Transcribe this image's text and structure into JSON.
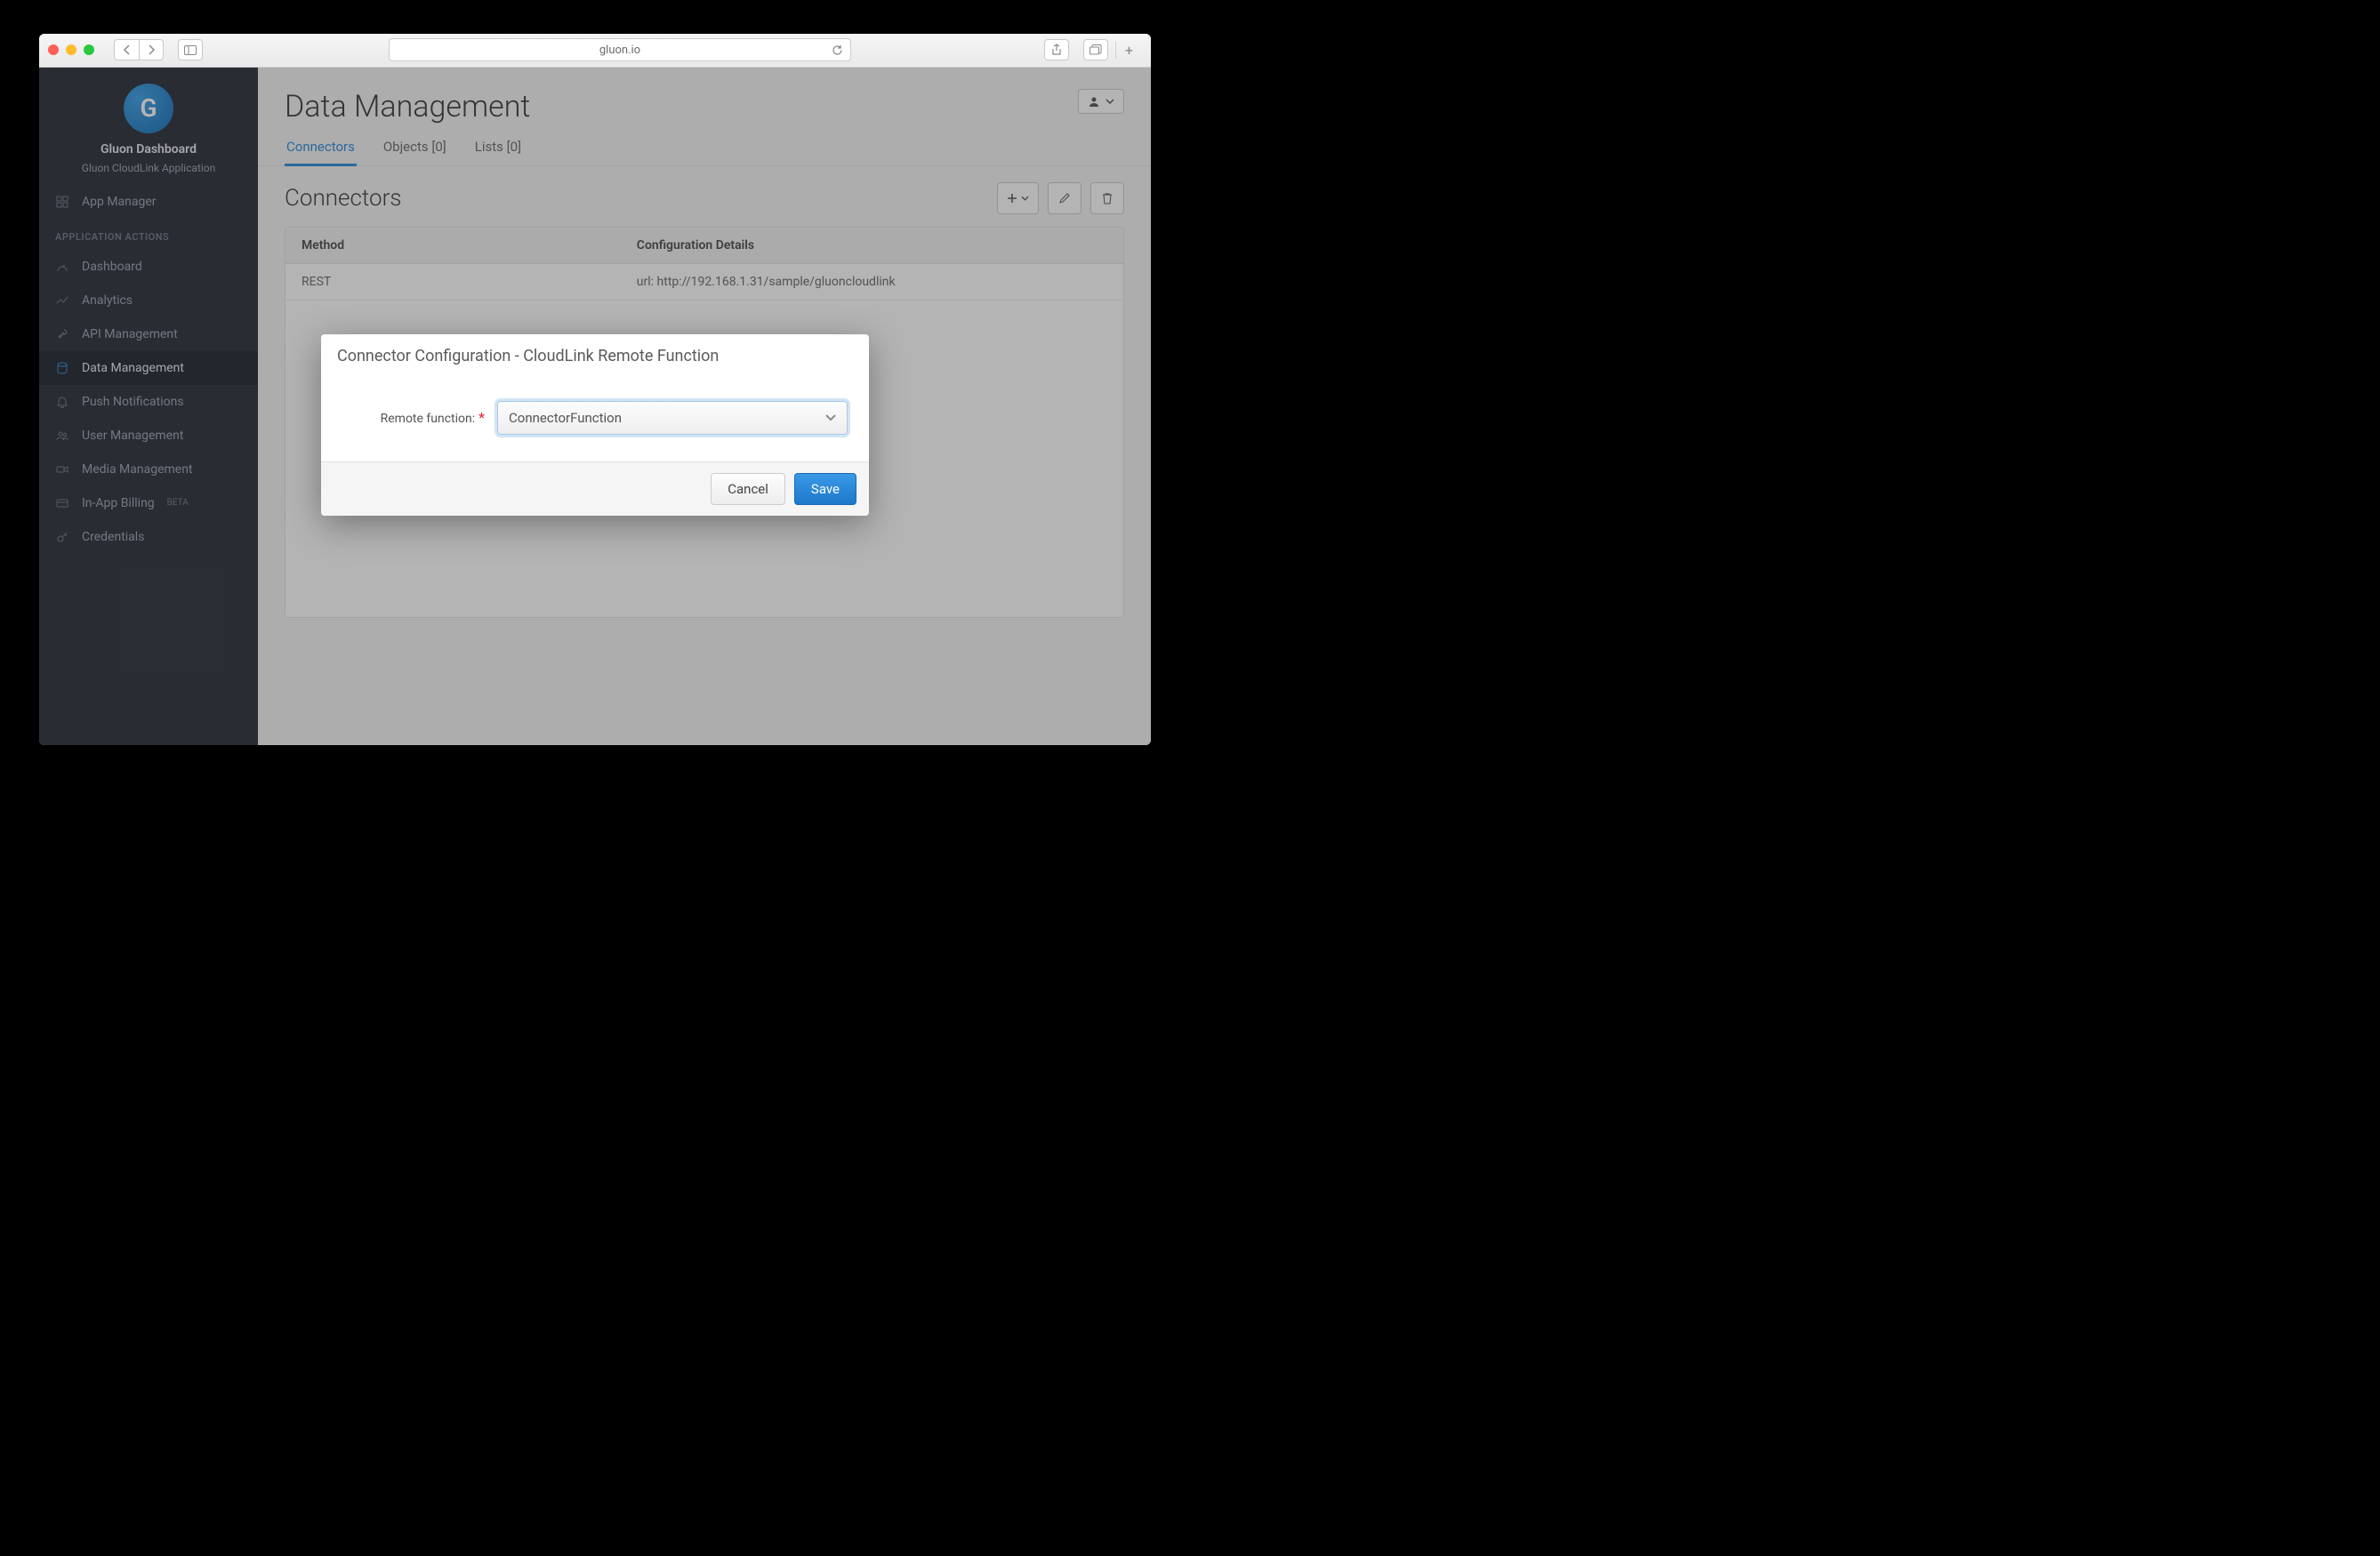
{
  "browser": {
    "url": "gluon.io"
  },
  "sidebar": {
    "title": "Gluon Dashboard",
    "subtitle": "Gluon CloudLink Application",
    "top_item": "App Manager",
    "section_label": "APPLICATION ACTIONS",
    "beta": "BETA",
    "items": [
      {
        "label": "Dashboard"
      },
      {
        "label": "Analytics"
      },
      {
        "label": "API Management"
      },
      {
        "label": "Data Management"
      },
      {
        "label": "Push Notifications"
      },
      {
        "label": "User Management"
      },
      {
        "label": "Media Management"
      },
      {
        "label": "In-App Billing"
      },
      {
        "label": "Credentials"
      }
    ]
  },
  "page": {
    "title": "Data Management",
    "tabs": [
      {
        "label": "Connectors"
      },
      {
        "label": "Objects [0]"
      },
      {
        "label": "Lists [0]"
      }
    ],
    "section_title": "Connectors",
    "table": {
      "headers": {
        "method": "Method",
        "config": "Configuration Details"
      },
      "rows": [
        {
          "method": "REST",
          "config": "url: http://192.168.1.31/sample/gluoncloudlink"
        }
      ]
    }
  },
  "modal": {
    "title": "Connector Configuration - CloudLink Remote Function",
    "label": "Remote function:",
    "value": "ConnectorFunction",
    "cancel": "Cancel",
    "save": "Save"
  }
}
